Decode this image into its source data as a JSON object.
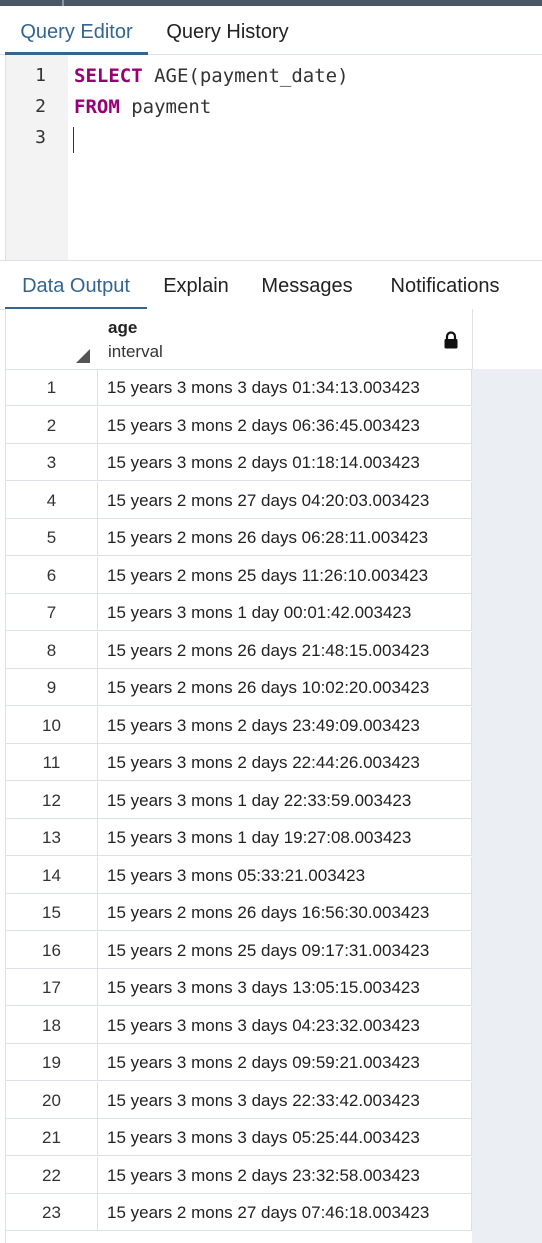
{
  "editor_tabs": [
    {
      "label": "Query Editor",
      "active": true
    },
    {
      "label": "Query History",
      "active": false
    }
  ],
  "editor": {
    "line_numbers": [
      "1",
      "2",
      "3"
    ],
    "lines": [
      {
        "keyword": "SELECT",
        "rest": " AGE(payment_date)"
      },
      {
        "keyword": "FROM",
        "rest": " payment"
      },
      {
        "keyword": "",
        "rest": ""
      }
    ]
  },
  "output_tabs": [
    {
      "label": "Data Output",
      "active": true
    },
    {
      "label": "Explain",
      "active": false
    },
    {
      "label": "Messages",
      "active": false
    },
    {
      "label": "Notifications",
      "active": false
    }
  ],
  "grid": {
    "column": {
      "name": "age",
      "type": "interval",
      "icon": "lock-icon"
    },
    "rows": [
      {
        "n": "1",
        "value": "15 years 3 mons 3 days 01:34:13.003423"
      },
      {
        "n": "2",
        "value": "15 years 3 mons 2 days 06:36:45.003423"
      },
      {
        "n": "3",
        "value": "15 years 3 mons 2 days 01:18:14.003423"
      },
      {
        "n": "4",
        "value": "15 years 2 mons 27 days 04:20:03.003423"
      },
      {
        "n": "5",
        "value": "15 years 2 mons 26 days 06:28:11.003423"
      },
      {
        "n": "6",
        "value": "15 years 2 mons 25 days 11:26:10.003423"
      },
      {
        "n": "7",
        "value": "15 years 3 mons 1 day 00:01:42.003423"
      },
      {
        "n": "8",
        "value": "15 years 2 mons 26 days 21:48:15.003423"
      },
      {
        "n": "9",
        "value": "15 years 2 mons 26 days 10:02:20.003423"
      },
      {
        "n": "10",
        "value": "15 years 3 mons 2 days 23:49:09.003423"
      },
      {
        "n": "11",
        "value": "15 years 3 mons 2 days 22:44:26.003423"
      },
      {
        "n": "12",
        "value": "15 years 3 mons 1 day 22:33:59.003423"
      },
      {
        "n": "13",
        "value": "15 years 3 mons 1 day 19:27:08.003423"
      },
      {
        "n": "14",
        "value": "15 years 3 mons 05:33:21.003423"
      },
      {
        "n": "15",
        "value": "15 years 2 mons 26 days 16:56:30.003423"
      },
      {
        "n": "16",
        "value": "15 years 2 mons 25 days 09:17:31.003423"
      },
      {
        "n": "17",
        "value": "15 years 3 mons 3 days 13:05:15.003423"
      },
      {
        "n": "18",
        "value": "15 years 3 mons 3 days 04:23:32.003423"
      },
      {
        "n": "19",
        "value": "15 years 3 mons 2 days 09:59:21.003423"
      },
      {
        "n": "20",
        "value": "15 years 3 mons 3 days 22:33:42.003423"
      },
      {
        "n": "21",
        "value": "15 years 3 mons 3 days 05:25:44.003423"
      },
      {
        "n": "22",
        "value": "15 years 3 mons 2 days 23:32:58.003423"
      },
      {
        "n": "23",
        "value": "15 years 2 mons 27 days 07:46:18.003423"
      }
    ]
  },
  "colors": {
    "accent": "#326690",
    "keyword": "#990073"
  }
}
